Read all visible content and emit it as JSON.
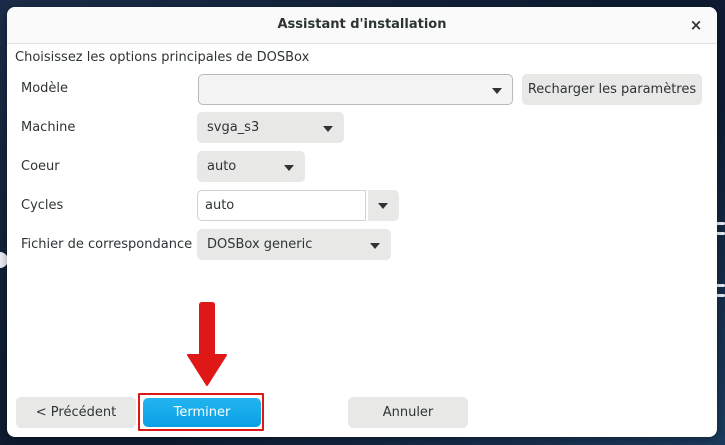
{
  "dialog": {
    "title": "Assistant d'installation",
    "close_glyph": "×",
    "subtitle": "Choisissez les options principales de DOSBox"
  },
  "form": {
    "model": {
      "label": "Modèle",
      "value": ""
    },
    "reload_button": "Recharger les paramètres",
    "machine": {
      "label": "Machine",
      "value": "svga_s3"
    },
    "core": {
      "label": "Coeur",
      "value": "auto"
    },
    "cycles": {
      "label": "Cycles",
      "value": "auto"
    },
    "mapping": {
      "label": "Fichier de correspondance",
      "value": "DOSBox generic"
    }
  },
  "footer": {
    "previous_button": "< Précédent",
    "finish_button": "Terminer",
    "cancel_button": "Annuler"
  },
  "colors": {
    "primary": "#0aa1e4",
    "annotation": "#e01717"
  },
  "icons": {
    "close": "close-icon",
    "dropdown": "chevron-down-icon",
    "annotation_arrow": "down-arrow-icon"
  }
}
